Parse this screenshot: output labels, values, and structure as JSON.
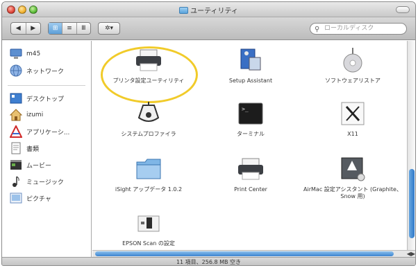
{
  "window": {
    "title": "ユーティリティ"
  },
  "toolbar": {
    "back": "◀",
    "forward": "▶",
    "view_icon": "⊞",
    "view_list": "≡",
    "view_column": "Ⅲ",
    "action": "✲▾",
    "search_placeholder": "ローカルディスク"
  },
  "sidebar": {
    "items": [
      {
        "label": "m45",
        "icon": "computer-icon"
      },
      {
        "label": "ネットワーク",
        "icon": "globe-icon"
      },
      {
        "label": "デスクトップ",
        "icon": "desktop-icon"
      },
      {
        "label": "izumi",
        "icon": "home-icon"
      },
      {
        "label": "アプリケーシ...",
        "icon": "applications-icon"
      },
      {
        "label": "書類",
        "icon": "documents-icon"
      },
      {
        "label": "ムービー",
        "icon": "movies-icon"
      },
      {
        "label": "ミュージック",
        "icon": "music-icon"
      },
      {
        "label": "ピクチャ",
        "icon": "pictures-icon"
      }
    ]
  },
  "apps": [
    {
      "label": "プリンタ設定ユーティリティ",
      "icon": "printer-icon"
    },
    {
      "label": "Setup Assistant",
      "icon": "setup-assistant-icon"
    },
    {
      "label": "ソフトウェアリストア",
      "icon": "software-restore-icon"
    },
    {
      "label": "システムプロファイラ",
      "icon": "system-profiler-icon"
    },
    {
      "label": "ターミナル",
      "icon": "terminal-icon"
    },
    {
      "label": "X11",
      "icon": "x11-icon"
    },
    {
      "label": "iSight アップデータ 1.0.2",
      "icon": "folder-icon"
    },
    {
      "label": "Print Center",
      "icon": "printer-icon"
    },
    {
      "label": "AirMac 設定アシスタント (Graphite、Snow 用)",
      "icon": "airmac-icon"
    },
    {
      "label": "EPSON Scan の設定",
      "icon": "epson-scan-icon"
    }
  ],
  "status": {
    "text": "11 項目、256.8 MB 空き"
  },
  "colors": {
    "highlight_ring": "#f1cb2a",
    "scroll_thumb": "#3a83cf"
  }
}
